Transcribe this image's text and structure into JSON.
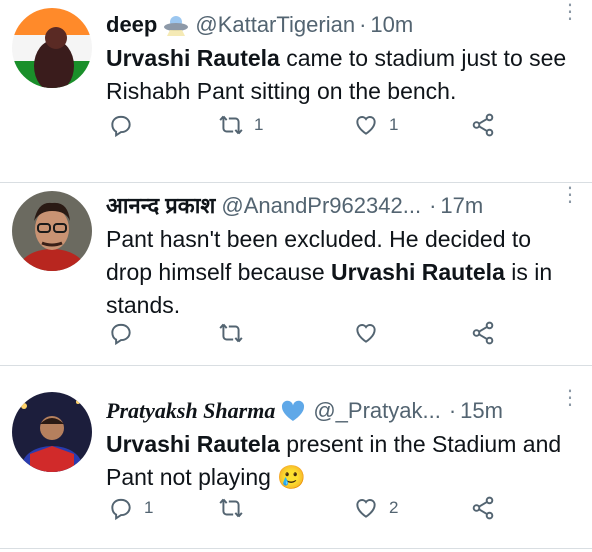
{
  "tweets": [
    {
      "name": "deep",
      "badge_icon": "ufo-icon",
      "handle": "@KattarTigerian",
      "separator": "·",
      "time": "10m",
      "text_bold": "Urvashi Rautela",
      "text_rest": " came to stadium just to see Rishabh Pant sitting on the bench.",
      "replies": "",
      "retweets": "1",
      "likes": "1"
    },
    {
      "name": "आनन्द प्रकाश",
      "handle": "@AnandPr962342...",
      "separator": "·",
      "time": "17m",
      "text_pre": "Pant hasn't been excluded. He decided to drop himself because ",
      "text_bold": "Urvashi Rautela",
      "text_post": " is in stands.",
      "replies": "",
      "retweets": "",
      "likes": ""
    },
    {
      "name": "Pratyaksh Sharma",
      "badge_icon": "blue-heart-icon",
      "handle": "@_Pratyak...",
      "separator": "·",
      "time": "15m",
      "text_bold": "Urvashi Rautela",
      "text_rest": " present in the Stadium and Pant not playing ",
      "emoji": "🥲",
      "replies": "1",
      "retweets": "",
      "likes": "2"
    }
  ],
  "icons": {
    "more": "more-dots-icon",
    "reply": "reply-icon",
    "retweet": "retweet-icon",
    "like": "heart-icon",
    "share": "share-icon"
  },
  "colors": {
    "text": "#0f1419",
    "secondary": "#536471",
    "divider": "#d9dee2",
    "heart_badge": "#5fa8e8"
  }
}
